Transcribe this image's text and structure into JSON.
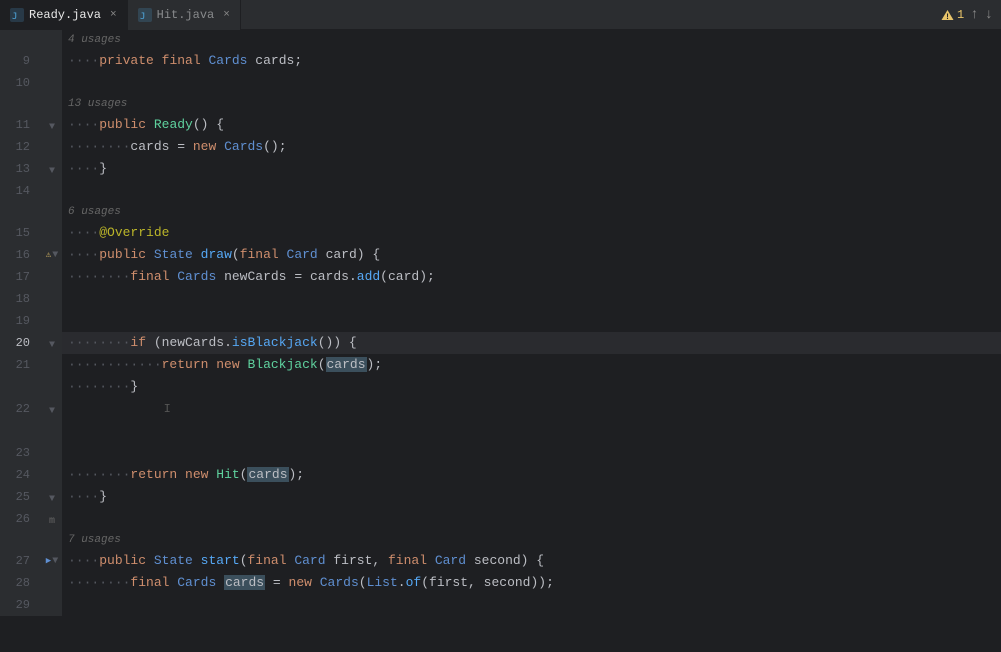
{
  "tabs": [
    {
      "id": "ready",
      "label": "Ready.java",
      "active": true,
      "icon_color": "#4ea6dc"
    },
    {
      "id": "hit",
      "label": "Hit.java",
      "active": false,
      "icon_color": "#4ea6dc"
    }
  ],
  "warning": {
    "count": 1,
    "label": "⚠ 1"
  },
  "lines": [
    {
      "num": 9,
      "type": "code",
      "indent": 2,
      "content": "private_final_cards_decl"
    },
    {
      "num": 10,
      "type": "empty"
    },
    {
      "num": null,
      "type": "usage",
      "text": "13 usages"
    },
    {
      "num": 11,
      "type": "code",
      "content": "constructor_decl"
    },
    {
      "num": 12,
      "type": "code",
      "content": "cards_assign"
    },
    {
      "num": 13,
      "type": "code",
      "content": "close_brace_1"
    },
    {
      "num": 14,
      "type": "empty"
    },
    {
      "num": null,
      "type": "usage",
      "text": "6 usages"
    },
    {
      "num": 15,
      "type": "code",
      "content": "override_ann"
    },
    {
      "num": 16,
      "type": "code",
      "content": "draw_method"
    },
    {
      "num": 17,
      "type": "code",
      "content": "newcards_assign"
    },
    {
      "num": 18,
      "type": "empty"
    },
    {
      "num": 19,
      "type": "empty"
    },
    {
      "num": 20,
      "type": "code",
      "content": "if_blackjack",
      "current": true
    },
    {
      "num": 21,
      "type": "code",
      "content": "return_blackjack"
    },
    {
      "num": 22,
      "type": "code",
      "content": "close_brace_2"
    },
    {
      "num": 23,
      "type": "empty"
    },
    {
      "num": 24,
      "type": "code",
      "content": "return_hit"
    },
    {
      "num": 25,
      "type": "code",
      "content": "close_brace_3"
    },
    {
      "num": 26,
      "type": "empty"
    },
    {
      "num": null,
      "type": "usage",
      "text": "7 usages"
    },
    {
      "num": 27,
      "type": "code",
      "content": "start_method"
    },
    {
      "num": 28,
      "type": "code",
      "content": "cards_listof"
    },
    {
      "num": 29,
      "type": "empty"
    }
  ],
  "colors": {
    "bg_editor": "#1e1f22",
    "bg_gutter": "#2b2d30",
    "bg_tab_active": "#1e1f22",
    "bg_tab_inactive": "#2b2d30",
    "keyword": "#cf8e6d",
    "type_color": "#5f8fd1",
    "method_color": "#56a8f5",
    "string_color": "#6aab73",
    "annotation": "#bbb529",
    "comment": "#7a7e85",
    "text": "#bcbec4"
  }
}
